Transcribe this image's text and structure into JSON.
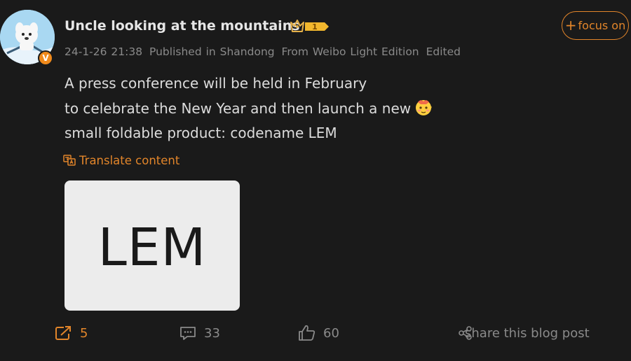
{
  "post": {
    "username": "Uncle looking at the mountains",
    "level_badge": "1",
    "verified_mark": "V",
    "meta": {
      "timestamp": "24-1-26 21:38",
      "location": "Published in Shandong",
      "source": "From Weibo Light Edition",
      "edited": "Edited"
    },
    "content_lines": [
      "A press conference will be held in February",
      "to celebrate the New Year and then launch a new",
      "small foldable product: codename LEM"
    ],
    "translate_label": "Translate content",
    "image_text": "LEM",
    "focus_label": "focus on"
  },
  "actions": {
    "repost_count": "5",
    "comment_count": "33",
    "like_count": "60",
    "share_label": "share this blog post"
  },
  "colors": {
    "background": "#1a1a1a",
    "accent": "#e2852a",
    "muted": "#8a8a8a",
    "text": "#dcdcdc"
  }
}
